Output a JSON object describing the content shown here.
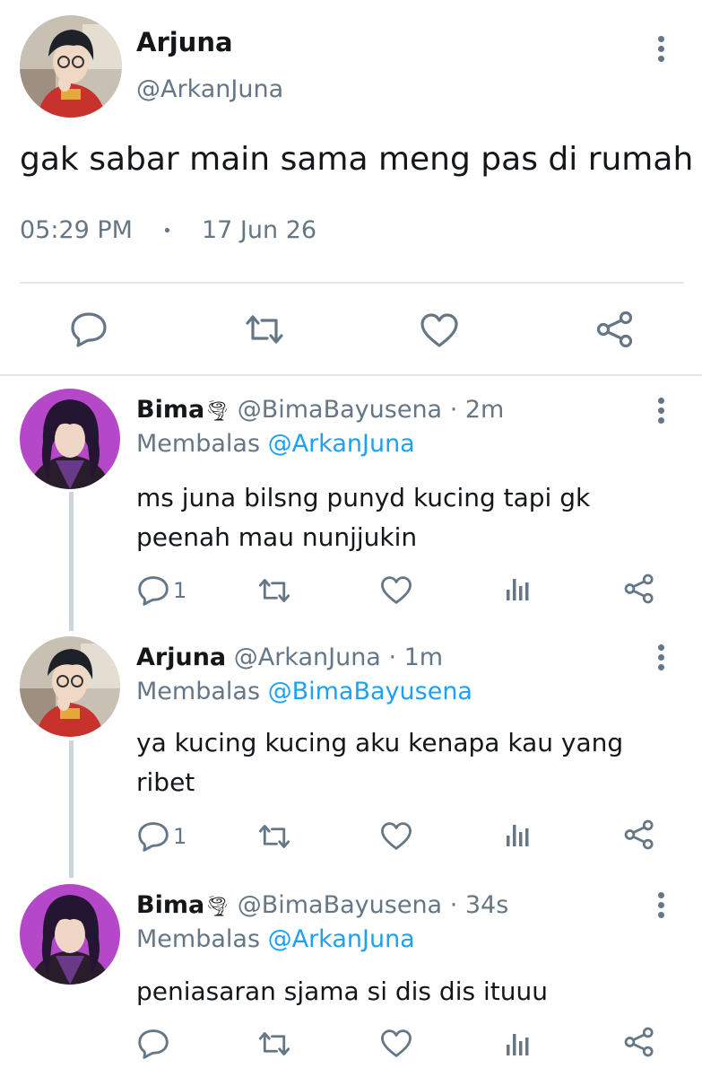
{
  "main_tweet": {
    "name": "Arjuna",
    "handle": "@ArkanJuna",
    "text": "gak sabar main sama meng pas di rumah",
    "time": "05:29 PM",
    "separator": "•",
    "date": "17 Jun 26"
  },
  "replies": [
    {
      "name": "Bima",
      "emoji": "🌪",
      "handle": "@BimaBayusena",
      "time": "· 2m",
      "replying_label": "Membalas",
      "replying_to": "@ArkanJuna",
      "text_line1": "ms juna bilsng punyd kucing tapi gk",
      "text_line2": "peenah mau nunjjukin",
      "reply_count": "1"
    },
    {
      "name": "Arjuna",
      "handle": "@ArkanJuna",
      "time": "· 1m",
      "replying_label": "Membalas",
      "replying_to": "@BimaBayusena",
      "text_line1": "ya kucing kucing aku kenapa kau yang",
      "text_line2": "ribet",
      "reply_count": "1"
    },
    {
      "name": "Bima",
      "emoji": "🌪",
      "handle": "@BimaBayusena",
      "time": "· 34s",
      "replying_label": "Membalas",
      "replying_to": "@ArkanJuna",
      "text_line1": "peniasaran sjama si dis dis ituuu"
    }
  ],
  "icons": [
    "more-vertical-icon",
    "reply-icon",
    "retweet-icon",
    "like-icon",
    "share-icon",
    "analytics-icon"
  ],
  "colors": {
    "link": "#1da1f2",
    "gray": "#657786",
    "divider": "#e1e8ed",
    "thread": "#ced5dc"
  }
}
